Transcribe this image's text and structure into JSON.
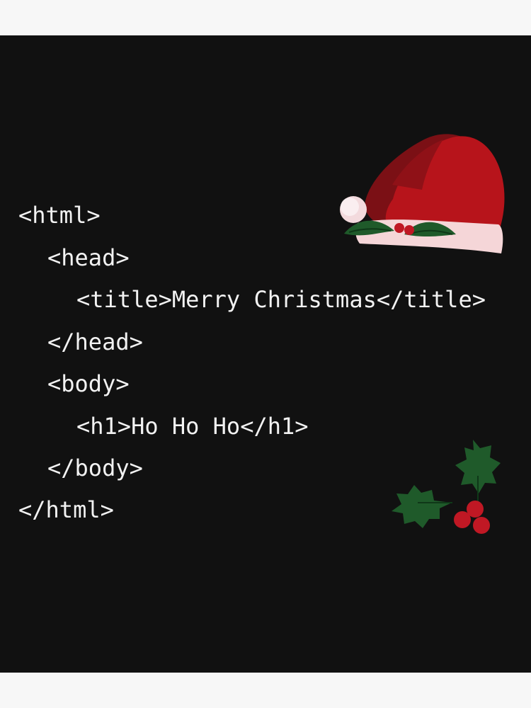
{
  "code": {
    "line_1": "<html>",
    "line_2": "<head>",
    "line_3": "<title>Merry Christmas</title>",
    "line_4": "</head>",
    "line_5": "<body>",
    "line_6": "<h1>Ho Ho Ho</h1>",
    "line_7": "</body>",
    "line_8": "</html>"
  },
  "colors": {
    "background": "#111111",
    "text": "#f2f2f2",
    "hat_red": "#b7141b",
    "hat_fur": "#f5d6d8",
    "holly_green": "#1f5a2a",
    "berry_red": "#c01824"
  },
  "icons": {
    "hat": "santa-hat-icon",
    "holly": "holly-icon"
  }
}
